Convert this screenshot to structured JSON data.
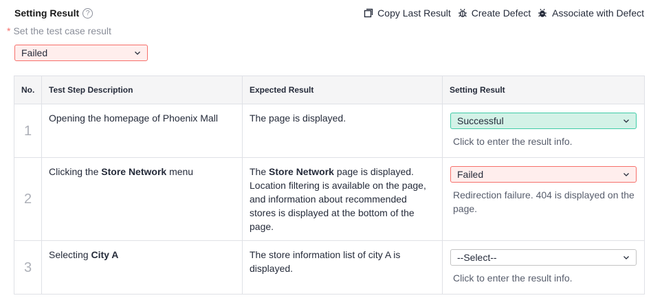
{
  "header": {
    "title": "Setting Result",
    "help_icon": "?",
    "actions": [
      {
        "label": "Copy Last Result",
        "icon": "copy-icon"
      },
      {
        "label": "Create Defect",
        "icon": "bug-icon"
      },
      {
        "label": "Associate with Defect",
        "icon": "bug-link-icon"
      }
    ]
  },
  "case_result": {
    "required_mark": "*",
    "label": "Set the test case result",
    "value": "Failed"
  },
  "table": {
    "columns": [
      "No.",
      "Test Step Description",
      "Expected Result",
      "Setting Result"
    ],
    "rows": [
      {
        "no": "1",
        "description_pre": "Opening the homepage of Phoenix Mall",
        "description_bold": "",
        "description_post": "",
        "expected_pre": "",
        "expected_bold": "",
        "expected_post": "The page is displayed.",
        "result": "Successful",
        "result_status": "success",
        "info": "Click to enter the result info."
      },
      {
        "no": "2",
        "description_pre": "Clicking the ",
        "description_bold": "Store Network",
        "description_post": " menu",
        "expected_pre": "The ",
        "expected_bold": "Store Network",
        "expected_post": " page is displayed. Location filtering is available on the page, and information about recommended stores is displayed at the bottom of the page.",
        "result": "Failed",
        "result_status": "failed",
        "info": "Redirection failure. 404 is displayed on the page."
      },
      {
        "no": "3",
        "description_pre": "Selecting ",
        "description_bold": "City A",
        "description_post": "",
        "expected_pre": "",
        "expected_bold": "",
        "expected_post": "The store information list of city A is displayed.",
        "result": "--Select--",
        "result_status": "empty",
        "info": "Click to enter the result info."
      }
    ]
  },
  "colors": {
    "failed_bg": "#ffeeed",
    "failed_border": "#f66f6a",
    "success_bg": "#d3f2e7",
    "success_border": "#3dcca6"
  }
}
